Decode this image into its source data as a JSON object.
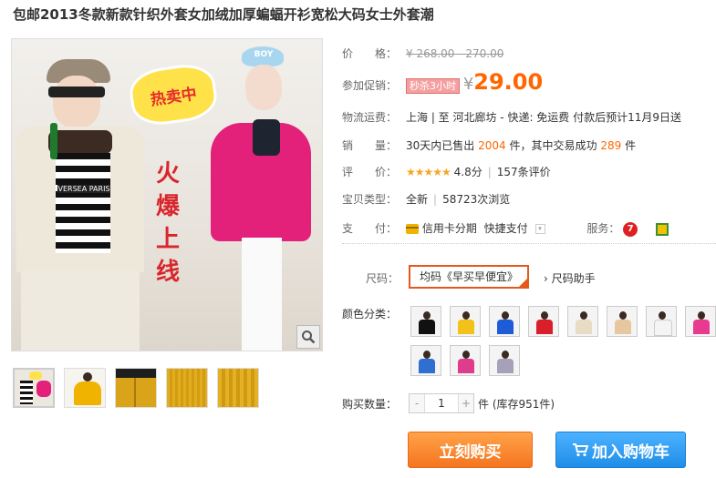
{
  "title": "包邮2013冬款新款针织外套女加绒加厚蝙蝠开衫宽松大码女士外套潮",
  "gallery": {
    "badge_text": "热卖中",
    "slogan": "火爆上线",
    "hat_text": "BOY",
    "shirt_text": "VERSEA PARIS",
    "thumb_count": 5
  },
  "price": {
    "label": "价　　格：",
    "original": "¥ 268.00 - 270.00",
    "promo_label": "参加促销：",
    "flash_badge": "秒杀3小时",
    "currency": "¥",
    "current": "29.00"
  },
  "shipping": {
    "label": "物流运费：",
    "text": "上海 | 至  河北廊坊 -     快递: 免运费  付款后预计11月9日送"
  },
  "sales": {
    "label": "销　　量：",
    "prefix": "30天内已售出",
    "sold": "2004",
    "mid": "件，其中交易成功",
    "success": "289",
    "suffix": "件"
  },
  "rating": {
    "label": "评　　价：",
    "stars": "★★★★★",
    "score": "4.8分",
    "count": "157条评价"
  },
  "item_type": {
    "label": "宝贝类型：",
    "condition": "全新",
    "views": "58723次浏览"
  },
  "payment": {
    "label": "支　　付：",
    "credit": "信用卡分期",
    "fast": "快捷支付",
    "service_label": "服务："
  },
  "size": {
    "label": "尺码：",
    "selected": "均码《早买早便宜》",
    "helper": "› 尺码助手"
  },
  "colors": {
    "label": "颜色分类：",
    "swatches": [
      "#111111",
      "#f2c11a",
      "#1e5bd6",
      "#d81f2a",
      "#e8dcc4",
      "#e7c7a0",
      "#f4f4f4",
      "#e83a8f",
      "#2f6fd0",
      "#e03c8c",
      "#a6a0b8"
    ]
  },
  "quantity": {
    "label": "购买数量：",
    "minus": "-",
    "value": "1",
    "plus": "+",
    "stock": "件 (库存951件)"
  },
  "actions": {
    "buy": "立刻购买",
    "cart": "加入购物车"
  }
}
